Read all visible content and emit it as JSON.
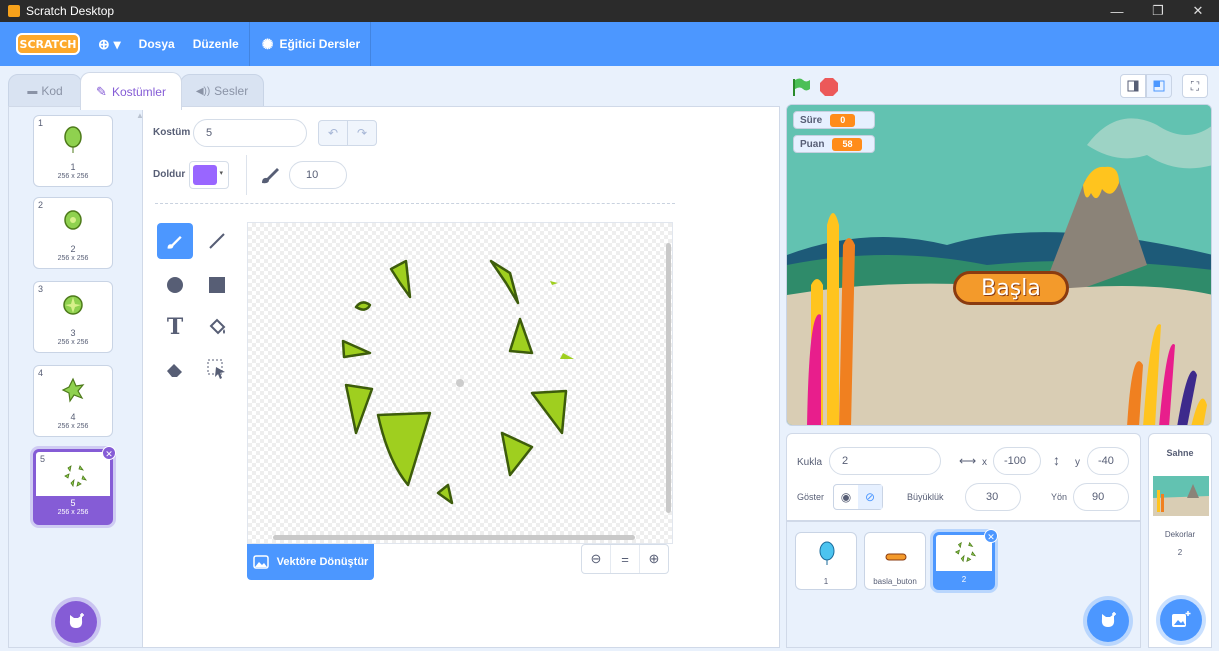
{
  "window": {
    "title": "Scratch Desktop",
    "minimize": "—",
    "restore": "❐",
    "close": "✕"
  },
  "menubar": {
    "logo": "SCRATCH",
    "language_icon": "⊕ ▾",
    "file": "Dosya",
    "edit": "Düzenle",
    "tutorials": "Eğitici Dersler"
  },
  "tabs": {
    "code": "Kod",
    "costumes": "Kostümler",
    "sounds": "Sesler"
  },
  "costumes": [
    {
      "num": "1",
      "name": "1",
      "size": "256 x 256"
    },
    {
      "num": "2",
      "name": "2",
      "size": "256 x 256"
    },
    {
      "num": "3",
      "name": "3",
      "size": "256 x 256"
    },
    {
      "num": "4",
      "name": "4",
      "size": "256 x 256"
    },
    {
      "num": "5",
      "name": "5",
      "size": "256 x 256"
    }
  ],
  "editor": {
    "costume_label": "Kostüm",
    "costume_name": "5",
    "fill_label": "Doldur",
    "fill_color": "#9966ff",
    "brush_size": "10",
    "convert_button": "Vektöre Dönüştür",
    "zoom_out": "⊖",
    "zoom_reset": "=",
    "zoom_in": "⊕"
  },
  "stage": {
    "monitors": [
      {
        "label": "Süre",
        "value": "0"
      },
      {
        "label": "Puan",
        "value": "58"
      }
    ],
    "start_button": "Başla"
  },
  "sprite_info": {
    "sprite_label": "Kukla",
    "sprite_name": "2",
    "x_label": "x",
    "x_value": "-100",
    "y_label": "y",
    "y_value": "-40",
    "show_label": "Göster",
    "size_label": "Büyüklük",
    "size_value": "30",
    "direction_label": "Yön",
    "direction_value": "90"
  },
  "sprites": [
    {
      "name": "1"
    },
    {
      "name": "basla_buton"
    },
    {
      "name": "2"
    }
  ],
  "stage_pane": {
    "title": "Sahne",
    "backdrops_label": "Dekorlar",
    "backdrops_count": "2"
  },
  "colors": {
    "accent": "#855cd6",
    "menubar": "#4c97ff",
    "fill": "#9966ff"
  }
}
